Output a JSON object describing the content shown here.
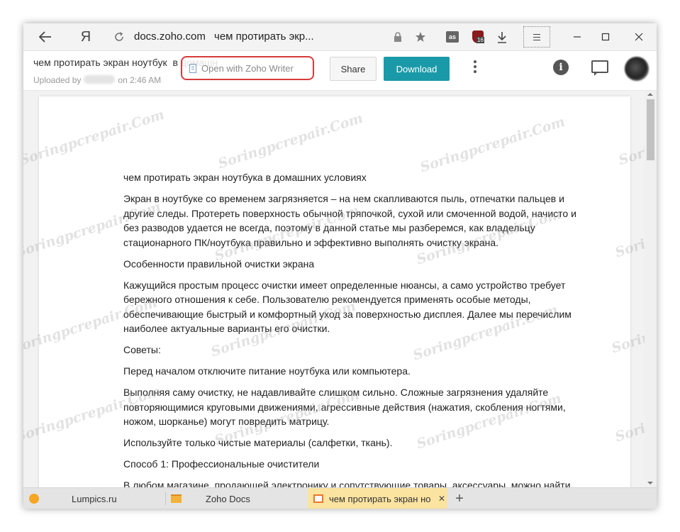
{
  "browser": {
    "brand_icon": "Я",
    "url_domain": "docs.zoho.com",
    "page_title": "чем протирать экр...",
    "ext_badge": "16"
  },
  "header": {
    "title": "чем протирать экран ноутбук",
    "title_tail": "в домашн",
    "uploaded_prefix": "Uploaded by",
    "uploaded_time": "on 2:46 AM",
    "open_writer": "Open with Zoho Writer",
    "share": "Share",
    "download": "Download",
    "accent_color": "#1a9aa8"
  },
  "document": {
    "paragraphs": [
      "чем протирать экран ноутбука в домашних условиях",
      "Экран в ноутбуке со временем загрязняется – на нем скапливаются пыль, отпечатки пальцев и другие следы. Протереть поверхность обычной тряпочкой, сухой или смоченной водой, начисто и без разводов удается не всегда, поэтому в данной статье мы разберемся, как владельцу стационарного ПК/ноутбука правильно и эффективно выполнять очистку экрана.",
      "Особенности правильной очистки экрана",
      "Кажущийся простым процесс очистки имеет определенные нюансы, а само устройство требует бережного отношения к себе. Пользователю рекомендуется применять особые методы, обеспечивающие быстрый и комфортный уход за поверхностью дисплея. Далее мы перечислим наиболее актуальные варианты его очистки.",
      "Советы:",
      "Перед началом отключите питание ноутбука или компьютера.",
      "Выполняя саму очистку, не надавливайте слишком сильно. Сложные загрязнения удаляйте повторяющимися круговыми движениями, агрессивные действия (нажатия, скобления ногтями, ножом, шорканье) могут повредить матрицу.",
      "Используйте только чистые материалы (салфетки, ткань).",
      "Способ 1: Профессиональные очистители",
      "В любом магазине, продающей электронику и сопутствующие товары, аксессуары, можно найти"
    ],
    "watermark": "Soringpcrepair.Com"
  },
  "tabs": [
    {
      "label": "Lumpics.ru"
    },
    {
      "label": "Zoho Docs"
    },
    {
      "label": "чем протирать экран но"
    }
  ],
  "tab_controls": {
    "close": "✕",
    "new_tab": "+"
  }
}
